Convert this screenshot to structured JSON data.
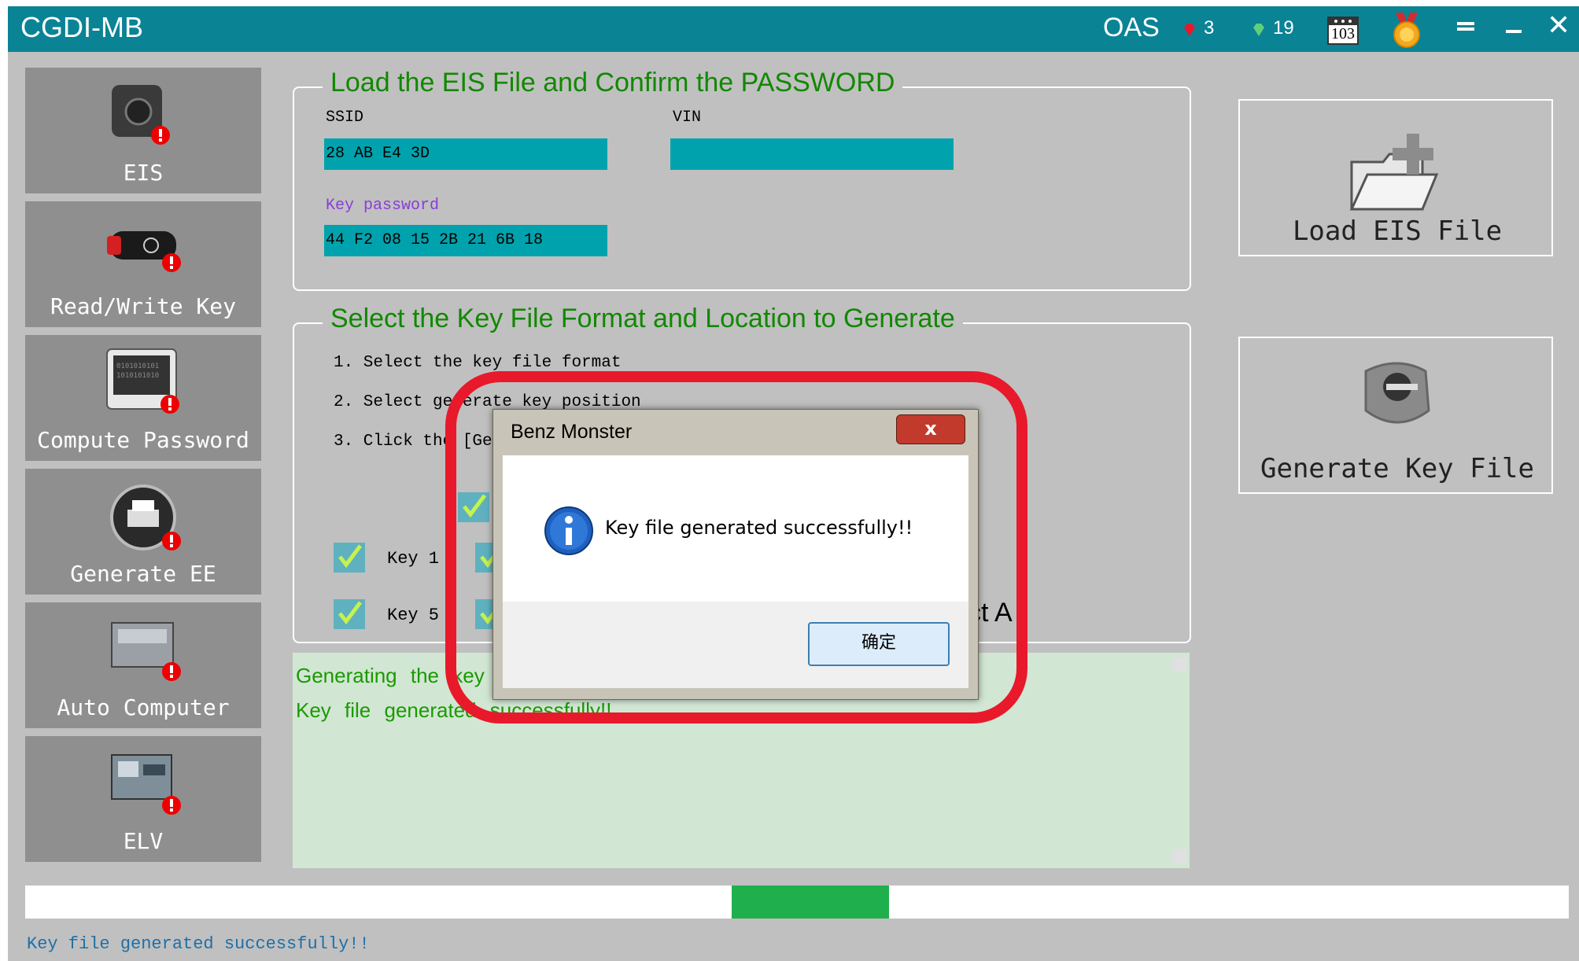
{
  "app": {
    "title": "CGDI-MB"
  },
  "titlebar": {
    "oas": "OAS",
    "red_gems": "3",
    "green_gems": "19",
    "calendar_value": "103",
    "icons": [
      "red-gem-icon",
      "green-gem-icon",
      "calendar-icon",
      "medal-icon",
      "menu-icon",
      "minimize-icon",
      "close-icon"
    ]
  },
  "sidebar": {
    "items": [
      {
        "label": "EIS",
        "icon": "eis-icon"
      },
      {
        "label": "Read/Write Key",
        "icon": "car-key-icon"
      },
      {
        "label": "Compute Password",
        "icon": "binary-screen-icon"
      },
      {
        "label": "Generate EE",
        "icon": "printer-icon"
      },
      {
        "label": "Auto Computer",
        "icon": "ecu-icon"
      },
      {
        "label": "ELV",
        "icon": "elv-module-icon"
      }
    ]
  },
  "load_section": {
    "legend": "Load the EIS File and Confirm the PASSWORD",
    "ssid_label": "SSID",
    "ssid_value": "28 AB E4 3D",
    "vin_label": "VIN",
    "vin_value": "",
    "key_password_label": "Key password",
    "key_password_value": "44 F2 08 15 2B 21 6B 18"
  },
  "generate_section": {
    "legend": "Select the Key File Format and Location to Generate",
    "step1": "1. Select the key file format",
    "step2": "2. Select generate key position",
    "step3": "3. Click the [Gen",
    "keys": [
      {
        "label": "Key 1",
        "checked": true
      },
      {
        "label": "Key 5",
        "checked": true
      }
    ],
    "select_all_fragment": "ct A"
  },
  "log": {
    "line1": "Generating the key",
    "line2": "Key file generated successfully!!"
  },
  "right_buttons": {
    "load_eis": "Load EIS File",
    "generate_key": "Generate Key File"
  },
  "progress": {
    "value": 0.13
  },
  "status": {
    "text": "Key file generated successfully!!"
  },
  "dialog": {
    "title": "Benz Monster",
    "close_label": "x",
    "message": "Key file generated successfully!!",
    "ok_label": "确定"
  },
  "colors": {
    "titlebar": "#0a8395",
    "window_bg": "#c0c0c0",
    "legend_green": "#118800",
    "field_teal": "#00a3ad",
    "log_bg": "#d2e6d4",
    "progress_green": "#1fb04d",
    "highlight_red": "#e8192b"
  }
}
